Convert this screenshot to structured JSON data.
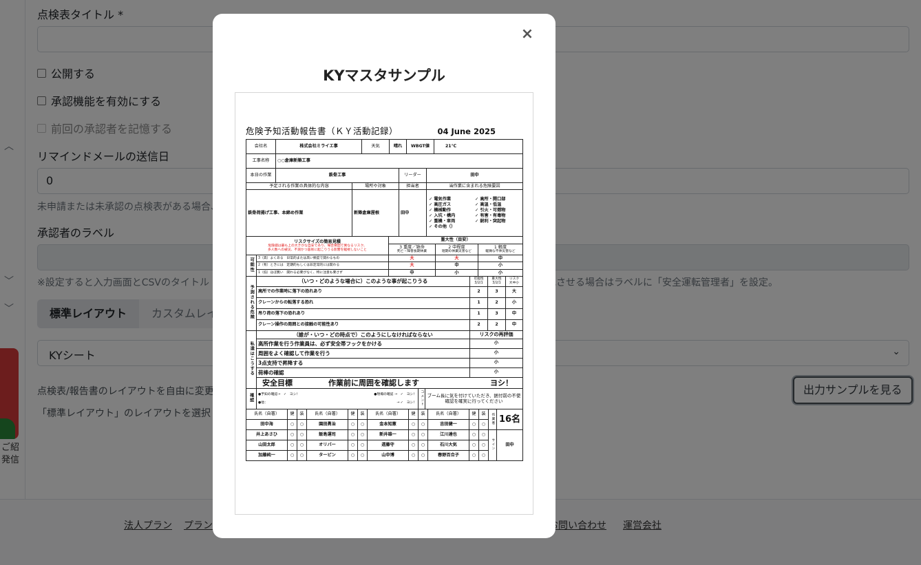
{
  "form": {
    "title_label": "点検表タイトル",
    "required_mark": "*",
    "publish_label": "公開する",
    "approval_label": "承認機能を有効にする",
    "remember_approver_label": "前回の承認者を記憶する",
    "reminder_label": "リマインドメールの送信日",
    "reminder_value": "0",
    "reminder_help": "未申請または未承認の点検表がある場合、",
    "approver_label_title": "承認者のラベル",
    "approver_help_left": "※設定すると入力画面とCSVのタイトル",
    "approver_help_right": "記させる場合はラベルに「安全運転管理者」を設定。",
    "tabs": [
      "標準レイアウト",
      "カスタムレイ"
    ],
    "layout_select_value": "KYシート",
    "layout_help_1": "点検表/報告書のレイアウトを自由に変更",
    "layout_help_2": "「標準レイアウト」のレイアウトを選択",
    "sample_button": "出力サンプルを見る"
  },
  "left_rail": {
    "text_1": "ご紹",
    "text_2": "発信"
  },
  "footer": {
    "links": [
      "法人プラン",
      "プラン",
      "お問い合わせ",
      "運営会社"
    ]
  },
  "modal": {
    "title": "KYマスタサンプル",
    "close_symbol": "×"
  },
  "report": {
    "title": "危険予知活動報告書（ＫＹ活動記録）",
    "date": "04 June 2025",
    "company_label": "会社名",
    "company": "株式会社ミライエ事",
    "weather_label": "天気",
    "weather": "晴れ",
    "wbgt_label": "WBGT値",
    "wbgt": "21℃",
    "project_label": "工事名称",
    "project": "○○倉庫新築工事",
    "today_work_label": "本日の作業",
    "today_work": "鉄骨工事",
    "leader_label": "リーダー",
    "leader": "田中",
    "col_task": "予定される作業の具体的な内容",
    "col_place": "場所や対象",
    "col_person": "担当者",
    "col_hazards": "当作業に含まれる危険要因",
    "task": "鉄骨荷揚げ工事、本締め作業",
    "place": "新築倉庫屋根",
    "person": "田中",
    "hazards": [
      "✓ 電気作業",
      "✓ 高所・開口部",
      "✓ 高圧ガス",
      "✓ 高温・低温",
      "✓ 機械動作",
      "✓ 引火・可燃物",
      "✓ 入坑・構内",
      "✓ 有害・有毒物",
      "✓ 重機・車両",
      "✓ 鋭利・突起物",
      "✓ その他（）"
    ],
    "risk_title": "リスクサイズの簡易見積",
    "risk_note_1": "危険値は最も上の大きかな自安であり、場合要因で異なるリスク、",
    "risk_note_2": "多人数への被災、不測かつ容易に起こりうる影響を軽視しないこと",
    "severity_title": "重大性（目安）",
    "severity_cols": [
      {
        "label": "3 重度／致命",
        "sub": "死亡・障害長期休業"
      },
      {
        "label": "2 中程度",
        "sub": "短期の休業災害など"
      },
      {
        "label": "1 軽度",
        "sub": "軽微な不休災害など"
      }
    ],
    "likelihood_label": "可能性",
    "likelihood_rows": [
      {
        "desc": "3（高）よくある　日常的または高い頻度で関わるもの",
        "cells": [
          "大",
          "大",
          "中"
        ]
      },
      {
        "desc": "2（有）ときには　定期的もしくは非定常的には関わる",
        "cells": [
          "大",
          "中",
          "小"
        ]
      },
      {
        "desc": "1（低）ほぼ無い　関わる必要がなく、特に注意も要さず",
        "cells": [
          "中",
          "小",
          "小"
        ]
      }
    ],
    "predict_label": "予測される危険",
    "predict_title": "（いつ・どのような場合に）このような事が起こりうる",
    "predict_cols": [
      "可能性 3/2/1",
      "重大性 3/2/1",
      "リスク 大中小"
    ],
    "predictions": [
      {
        "text": "高所での作業時に落下の恐れあり",
        "p": "2",
        "s": "3",
        "r": "大"
      },
      {
        "text": "クレーンからの転落する恐れ",
        "p": "1",
        "s": "2",
        "r": "小"
      },
      {
        "text": "吊り荷の落下の恐れあり",
        "p": "1",
        "s": "3",
        "r": "中"
      },
      {
        "text": "クレーン操作の周囲との接触の可能性あり",
        "p": "2",
        "s": "2",
        "r": "中"
      }
    ],
    "measure_label": "私達はこうする",
    "measure_title": "（誰が・いつ・どの時点で）このようにしなければならない",
    "reeval_title": "リスクの再評価",
    "measures": [
      {
        "text": "高所作業を行う作業員は、必ず安全帯フックをかける",
        "r": "小"
      },
      {
        "text": "周囲をよく確認して作業を行う",
        "r": "小"
      },
      {
        "text": "3点支持で昇降する",
        "r": "小"
      },
      {
        "text": "荷棒の確認",
        "r": "小"
      }
    ],
    "goal_label": "安全目標",
    "goal": "作業前に周囲を確認します",
    "goal_call": "ヨシ！",
    "confirm_label": "確認",
    "confirm_1": "●予知の確認→　✓　ヨシ！",
    "confirm_2": "●現場の確認 →　✓　ヨシ！",
    "confirm_3": "●他：",
    "confirm_4": "→ ✓　ヨシ！",
    "comment_label": "コメント",
    "comment": "ブーム長に気を付けていただき、据付前の不使確認を確実に行ってください",
    "sign_head": [
      "氏名（自署）",
      "健",
      "装"
    ],
    "workers_label": "作業者",
    "workers_count": "16名",
    "sign_label": "サイン",
    "sign_value": "田中",
    "mark": "○",
    "names": [
      [
        "田中海",
        "園田勇治",
        "金本知憲",
        "吉田健一"
      ],
      [
        "井上あさひ",
        "飯島運司",
        "新井雄一",
        "江川達也"
      ],
      [
        "山田太郎",
        "オリバー",
        "遠藤守",
        "石川大気"
      ],
      [
        "加藤純一",
        "ターピン",
        "山中博",
        "春野百合子"
      ]
    ]
  }
}
